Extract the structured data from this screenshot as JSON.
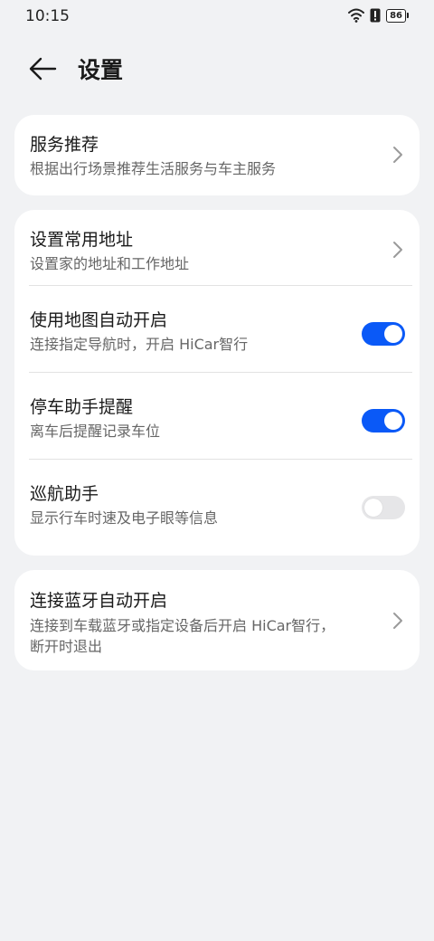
{
  "status_bar": {
    "time": "10:15",
    "battery": "86",
    "icons": [
      "wifi-icon",
      "alert-icon",
      "battery-icon"
    ]
  },
  "header": {
    "back_icon": "arrow-left-icon",
    "title": "设置"
  },
  "cards": {
    "service": {
      "title": "服务推荐",
      "subtitle": "根据出行场景推荐生活服务与车主服务"
    },
    "settings": {
      "address": {
        "title": "设置常用地址",
        "subtitle": "设置家的地址和工作地址"
      },
      "auto_open": {
        "title": "使用地图自动开启",
        "subtitle": "连接指定导航时，开启 HiCar智行",
        "enabled": true
      },
      "parking": {
        "title": "停车助手提醒",
        "subtitle": "离车后提醒记录车位",
        "enabled": true
      },
      "cruise": {
        "title": "巡航助手",
        "subtitle": "显示行车时速及电子眼等信息",
        "enabled": false
      }
    },
    "bluetooth": {
      "title": "连接蓝牙自动开启",
      "subtitle_line1": "连接到车载蓝牙或指定设备后开启 HiCar智行，",
      "subtitle_line2": "断开时退出"
    }
  },
  "colors": {
    "background": "#f1f2f4",
    "card": "#ffffff",
    "toggle_on": "#0a59f7",
    "toggle_off": "#e6e6e8"
  }
}
